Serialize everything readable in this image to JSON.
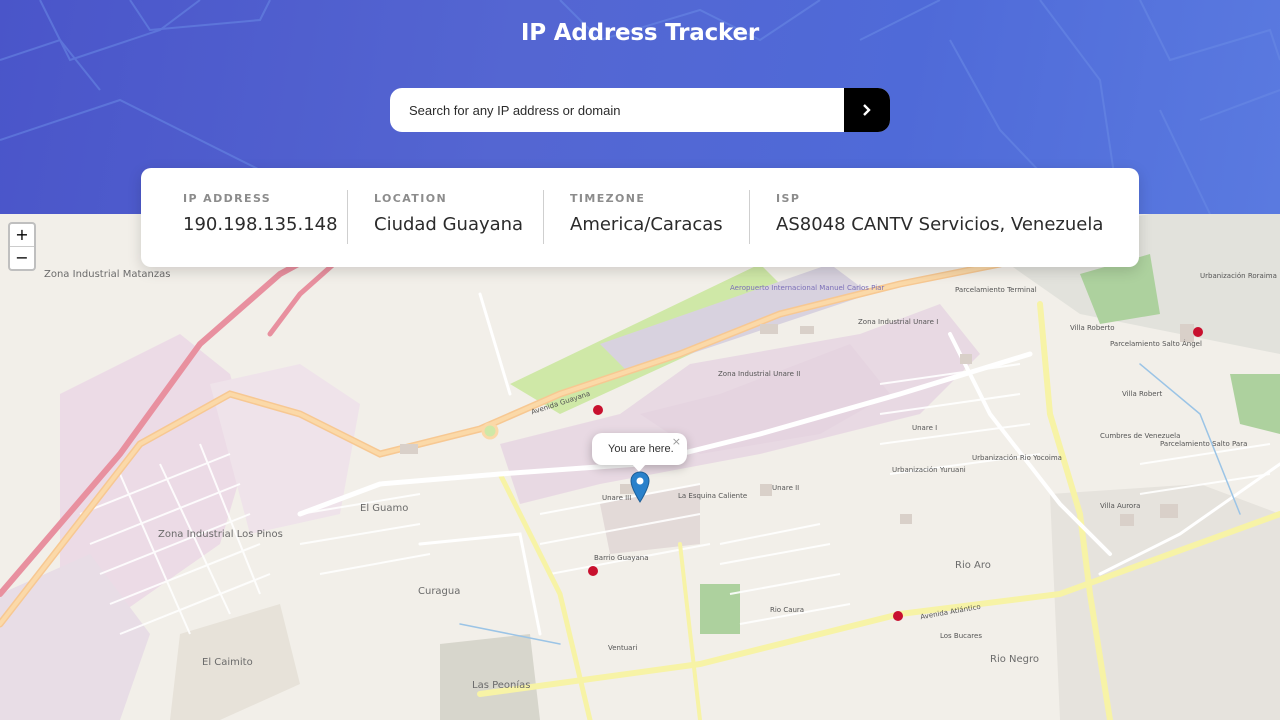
{
  "header": {
    "title": "IP Address Tracker"
  },
  "search": {
    "placeholder": "Search for any IP address or domain",
    "value": "",
    "submit_icon": "chevron-right-icon"
  },
  "info": {
    "ip": {
      "label": "IP Address",
      "value": "190.198.135.148"
    },
    "location": {
      "label": "Location",
      "value": "Ciudad Guayana"
    },
    "timezone": {
      "label": "Timezone",
      "value": "America/Caracas"
    },
    "isp": {
      "label": "ISP",
      "value": "AS8048 CANTV Servicios, Venezuela"
    }
  },
  "map": {
    "zoom_in": "+",
    "zoom_out": "−",
    "popup_text": "You are here.",
    "popup_close": "×",
    "labels": {
      "zona_matanzas": "Zona Industrial Matanzas",
      "zona_los_pinos": "Zona Industrial Los Pinos",
      "el_guamo": "El Guamo",
      "curagua": "Curagua",
      "el_caimito": "El Caimito",
      "las_peonias": "Las Peonías",
      "parcelamiento_terminal": "Parcelamiento Terminal",
      "salto_angel": "Parcelamiento Salto Ángel",
      "salto_para": "Parcelamiento Salto Para",
      "rio_aro": "Rio Aro",
      "rio_negro": "Rio Negro",
      "los_bucares": "Los Bucares",
      "rio_caura": "Rio Caura",
      "ventuari": "Ventuari",
      "aeropuerto": "Aeropuerto Internacional Manuel Carlos Piar",
      "avenida_guayana": "Avenida Guayana",
      "avenida_atlantico": "Avenida Atlántico",
      "urbanizacion_roraima": "Urbanización Roraima",
      "unare_ii": "Unare II",
      "unare_i": "Unare I",
      "unare_iii": "Unare III",
      "villa_roberto": "Villa Roberto",
      "villa_robert": "Villa Robert",
      "villa_aurora": "Villa Aurora",
      "cumbres": "Cumbres de Venezuela",
      "zona_unare_i": "Zona Industrial Unare I",
      "zona_unare_ii": "Zona Industrial Unare II",
      "barrio_guayana": "Barrio Guayana",
      "la_esquina": "La Esquina Caliente",
      "urbanizacion_yuruani": "Urbanización Yuruani",
      "rio_yocoima": "Urbanización Rio Yocoima"
    }
  },
  "colors": {
    "hero": "#5466d2",
    "button": "#000000",
    "marker": "#2a81cb"
  }
}
